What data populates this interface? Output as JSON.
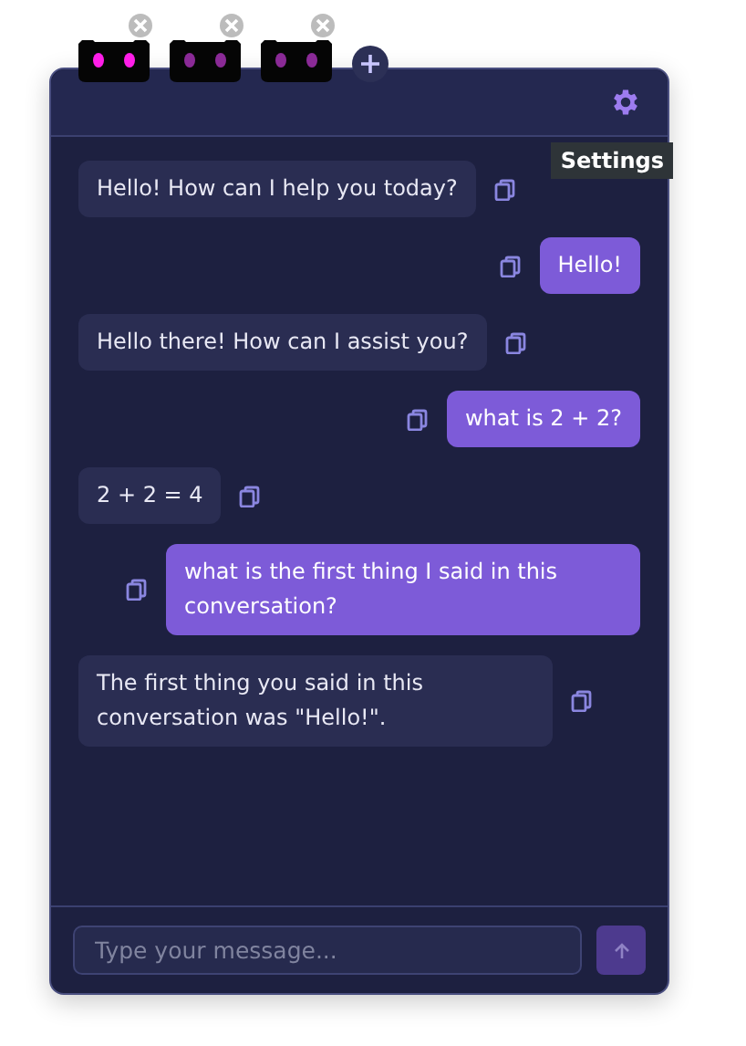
{
  "tabs": [
    {
      "selected": true
    },
    {
      "selected": false
    },
    {
      "selected": false
    }
  ],
  "header": {
    "tooltip": "Settings"
  },
  "messages": [
    {
      "kind": "assistant",
      "text": "Hello! How can I help you today?"
    },
    {
      "kind": "user",
      "text": "Hello!"
    },
    {
      "kind": "assistant",
      "text": "Hello there!  How can I assist you?"
    },
    {
      "kind": "user",
      "text": "what is 2 + 2?"
    },
    {
      "kind": "assistant",
      "text": "2 + 2 = 4"
    },
    {
      "kind": "user",
      "text": "what is the first thing I said in this conversation?"
    },
    {
      "kind": "assistant",
      "text": "The first thing you said in this conversation was \"Hello!\"."
    }
  ],
  "composer": {
    "placeholder": "Type your message..."
  }
}
